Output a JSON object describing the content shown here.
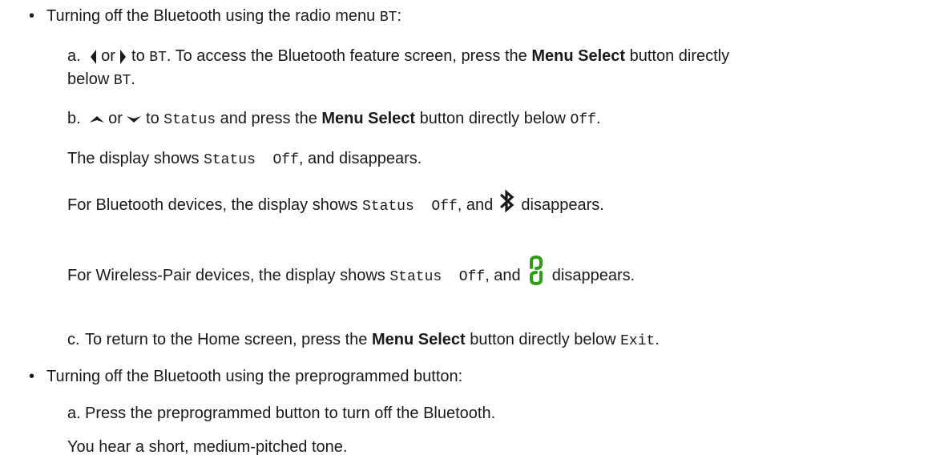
{
  "section1": {
    "bullet": "•",
    "intro_text": "Turning off the Bluetooth using the radio menu ",
    "intro_code": "BT",
    "intro_end": ":",
    "step_a": {
      "label": "a.",
      "or_text": " or ",
      "to_text": " to ",
      "code_bt": "BT",
      "text1": ". To access the Bluetooth feature screen, press the ",
      "bold": "Menu Select",
      "text2": " button directly",
      "line2_text": "below ",
      "line2_code": "BT",
      "line2_end": "."
    },
    "step_b": {
      "label": "b.",
      "or_text": " or ",
      "to_text": " to ",
      "code_status": "Status",
      "text1": " and press the ",
      "bold": "Menu Select",
      "text2": " button directly below ",
      "code_off": "Off",
      "end": "."
    },
    "display1": {
      "text1": "The display shows ",
      "code": "Status  Off",
      "text2": ", and disappears."
    },
    "display2": {
      "text1": "For Bluetooth devices, the display shows ",
      "code": "Status  Off",
      "text2": ", and ",
      "text3": " disappears."
    },
    "display3": {
      "text1": "For Wireless-Pair devices, the display shows ",
      "code": "Status  Off",
      "text2": ", and ",
      "text3": " disappears."
    },
    "step_c": {
      "label": "c.",
      "text1": "To return to the Home screen, press the ",
      "bold": "Menu Select",
      "text2": " button directly below ",
      "code": "Exit",
      "end": "."
    }
  },
  "section2": {
    "bullet": "•",
    "intro_text": "Turning off the Bluetooth using the preprogrammed button:",
    "step_a": {
      "label": "a.",
      "text": "Press the preprogrammed button to turn off the Bluetooth."
    },
    "tone": "You hear a short, medium-pitched tone."
  },
  "colors": {
    "text": "#1a1a1a",
    "pair_icon": "#2e9e1a"
  },
  "icons": [
    "left-arrow-icon",
    "right-arrow-icon",
    "up-arrow-icon",
    "down-arrow-icon",
    "bluetooth-icon",
    "wireless-pair-icon"
  ]
}
